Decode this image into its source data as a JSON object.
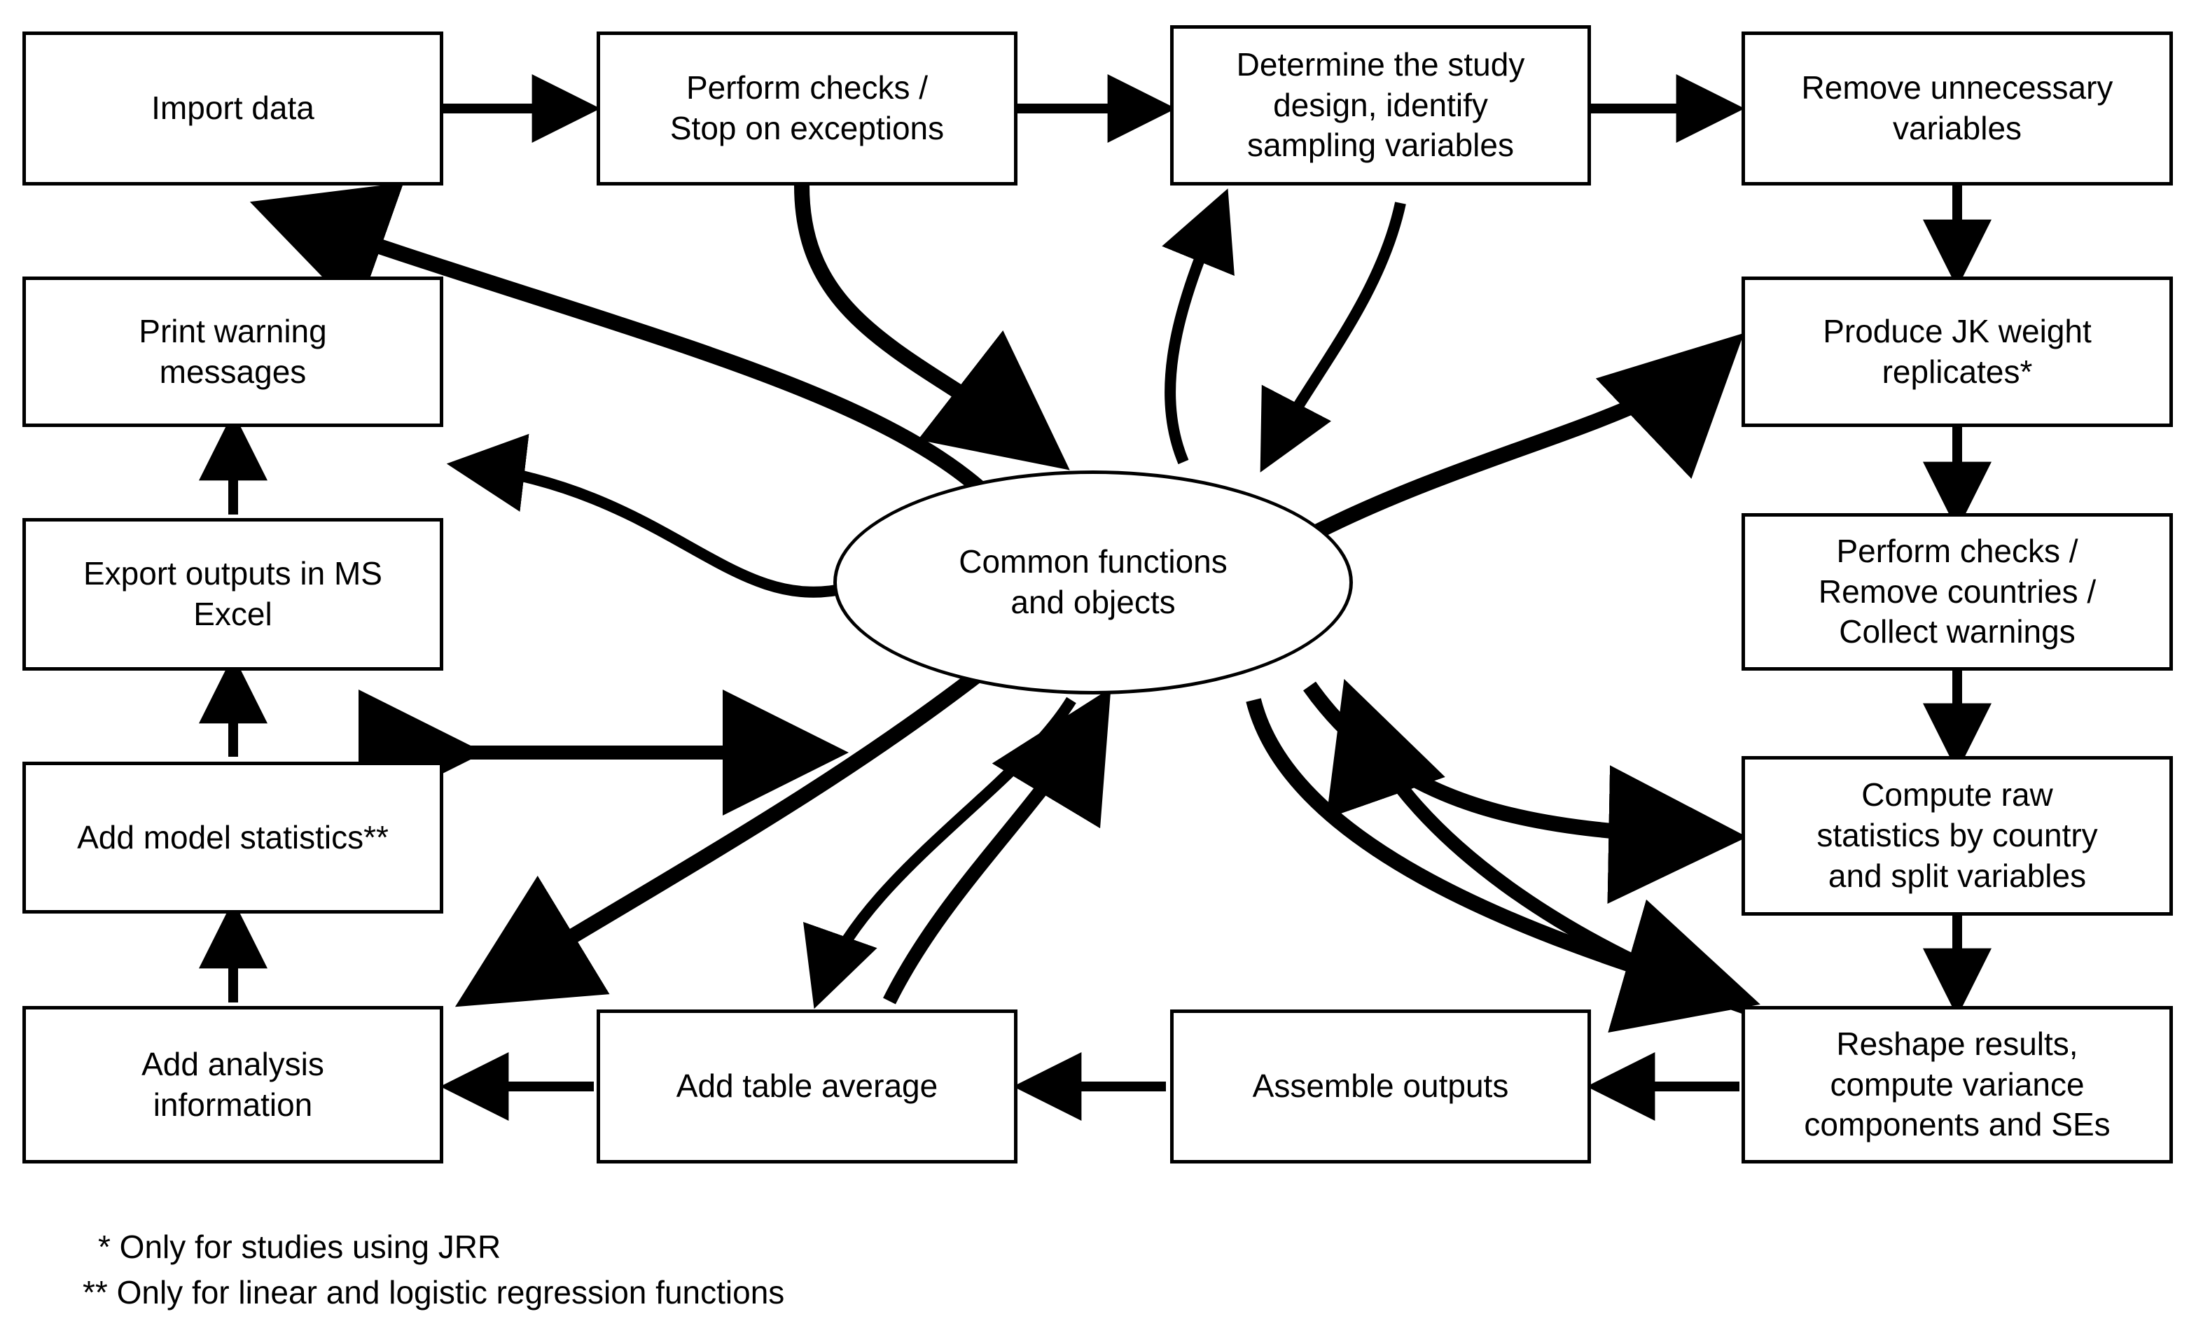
{
  "diagram": {
    "title_text": "",
    "stroke_color": "#000000",
    "fill_color": "#ffffff",
    "nodes": {
      "import_data": "Import data",
      "perform_checks_stop": "Perform checks /\nStop on exceptions",
      "determine_study_design": "Determine the study\ndesign, identify\nsampling variables",
      "remove_unnecessary_variables": "Remove unnecessary\nvariables",
      "produce_jk_weight_replicates": "Produce JK weight\nreplicates*",
      "perform_checks_remove_countries": "Perform checks /\nRemove countries /\nCollect warnings",
      "compute_raw_statistics": "Compute raw\nstatistics by country\nand split variables",
      "reshape_results": "Reshape results,\ncompute variance\ncomponents and SEs",
      "assemble_outputs": "Assemble outputs",
      "add_table_average": "Add table average",
      "add_analysis_information": "Add analysis\ninformation",
      "add_model_statistics": "Add model statistics**",
      "export_outputs_excel": "Export outputs in MS\nExcel",
      "print_warning_messages": "Print warning\nmessages",
      "common_functions": "Common functions\nand objects"
    },
    "footnotes": [
      "* Only for studies using JRR",
      "** Only for linear and logistic regression functions"
    ]
  },
  "chart_data": {
    "type": "diagram",
    "title": "",
    "flow_order": [
      "Import data",
      "Perform checks / Stop on exceptions",
      "Determine the study design, identify sampling variables",
      "Remove unnecessary variables",
      "Produce JK weight replicates*",
      "Perform checks / Remove countries / Collect warnings",
      "Compute raw statistics by country and split variables",
      "Reshape results, compute variance components and SEs",
      "Assemble outputs",
      "Add table average",
      "Add analysis information",
      "Add model statistics**",
      "Export outputs in MS Excel",
      "Print warning messages"
    ],
    "hub": "Common functions and objects",
    "edges": [
      {
        "from": "Import data",
        "to": "Perform checks / Stop on exceptions",
        "style": "straight"
      },
      {
        "from": "Perform checks / Stop on exceptions",
        "to": "Determine the study design, identify sampling variables",
        "style": "straight"
      },
      {
        "from": "Determine the study design, identify sampling variables",
        "to": "Remove unnecessary variables",
        "style": "straight"
      },
      {
        "from": "Remove unnecessary variables",
        "to": "Produce JK weight replicates*",
        "style": "straight"
      },
      {
        "from": "Produce JK weight replicates*",
        "to": "Perform checks / Remove countries / Collect warnings",
        "style": "straight"
      },
      {
        "from": "Perform checks / Remove countries / Collect warnings",
        "to": "Compute raw statistics by country and split variables",
        "style": "straight"
      },
      {
        "from": "Compute raw statistics by country and split variables",
        "to": "Reshape results, compute variance components and SEs",
        "style": "straight"
      },
      {
        "from": "Reshape results, compute variance components and SEs",
        "to": "Assemble outputs",
        "style": "straight"
      },
      {
        "from": "Assemble outputs",
        "to": "Add table average",
        "style": "straight"
      },
      {
        "from": "Add table average",
        "to": "Add analysis information",
        "style": "straight"
      },
      {
        "from": "Add analysis information",
        "to": "Add model statistics**",
        "style": "straight"
      },
      {
        "from": "Add model statistics**",
        "to": "Export outputs in MS Excel",
        "style": "straight"
      },
      {
        "from": "Export outputs in MS Excel",
        "to": "Print warning messages",
        "style": "straight"
      },
      {
        "from": "Perform checks / Stop on exceptions",
        "to": "Common functions and objects",
        "style": "curved"
      },
      {
        "from": "Common functions and objects",
        "to": "Import data",
        "style": "curved"
      },
      {
        "from": "Common functions and objects",
        "to": "Determine the study design, identify sampling variables",
        "style": "curved"
      },
      {
        "from": "Determine the study design, identify sampling variables",
        "to": "Common functions and objects",
        "style": "curved"
      },
      {
        "from": "Common functions and objects",
        "to": "Produce JK weight replicates*",
        "style": "curved"
      },
      {
        "from": "Common functions and objects",
        "to": "Print warning messages",
        "style": "curved"
      },
      {
        "from": "Export outputs in MS Excel",
        "to": "Common functions and objects",
        "style": "bidirectional"
      },
      {
        "from": "Common functions and objects",
        "to": "Add analysis information",
        "style": "curved"
      },
      {
        "from": "Common functions and objects",
        "to": "Add table average",
        "style": "curved"
      },
      {
        "from": "Add table average",
        "to": "Common functions and objects",
        "style": "curved"
      },
      {
        "from": "Common functions and objects",
        "to": "Compute raw statistics by country and split variables",
        "style": "curved"
      },
      {
        "from": "Reshape results, compute variance components and SEs",
        "to": "Common functions and objects",
        "style": "curved"
      },
      {
        "from": "Common functions and objects",
        "to": "Reshape results, compute variance components and SEs",
        "style": "curved"
      }
    ]
  }
}
